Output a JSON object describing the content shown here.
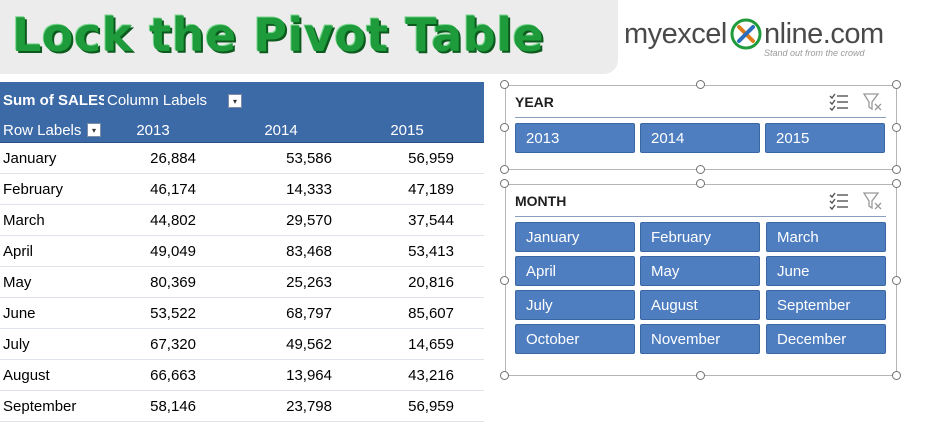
{
  "banner": {
    "title": "Lock the Pivot Table"
  },
  "logo": {
    "brand_left": "myexcel",
    "brand_right": "nline.com",
    "tagline": "Stand out from the crowd"
  },
  "pivot": {
    "header": {
      "sum_label": "Sum of SALES",
      "column_labels": "Column Labels",
      "row_labels": "Row Labels"
    },
    "years": [
      "2013",
      "2014",
      "2015"
    ],
    "rows": [
      {
        "month": "January",
        "v2013": "26,884",
        "v2014": "53,586",
        "v2015": "56,959"
      },
      {
        "month": "February",
        "v2013": "46,174",
        "v2014": "14,333",
        "v2015": "47,189"
      },
      {
        "month": "March",
        "v2013": "44,802",
        "v2014": "29,570",
        "v2015": "37,544"
      },
      {
        "month": "April",
        "v2013": "49,049",
        "v2014": "83,468",
        "v2015": "53,413"
      },
      {
        "month": "May",
        "v2013": "80,369",
        "v2014": "25,263",
        "v2015": "20,816"
      },
      {
        "month": "June",
        "v2013": "53,522",
        "v2014": "68,797",
        "v2015": "85,607"
      },
      {
        "month": "July",
        "v2013": "67,320",
        "v2014": "49,562",
        "v2015": "14,659"
      },
      {
        "month": "August",
        "v2013": "66,663",
        "v2014": "13,964",
        "v2015": "43,216"
      },
      {
        "month": "September",
        "v2013": "58,146",
        "v2014": "23,798",
        "v2015": "56,959"
      }
    ]
  },
  "slicers": {
    "year": {
      "title": "YEAR",
      "items": [
        "2013",
        "2014",
        "2015"
      ]
    },
    "month": {
      "title": "MONTH",
      "items": [
        "January",
        "February",
        "March",
        "April",
        "May",
        "June",
        "July",
        "August",
        "September",
        "October",
        "November",
        "December"
      ]
    }
  },
  "colors": {
    "header_blue": "#3c6aa7",
    "slicer_item": "#4f7ec0",
    "title_green": "#1e9b3a"
  },
  "icons": {
    "multi_select": "multi-select-icon",
    "clear_filter": "clear-filter-icon",
    "dropdown": "dropdown-filter-icon"
  }
}
